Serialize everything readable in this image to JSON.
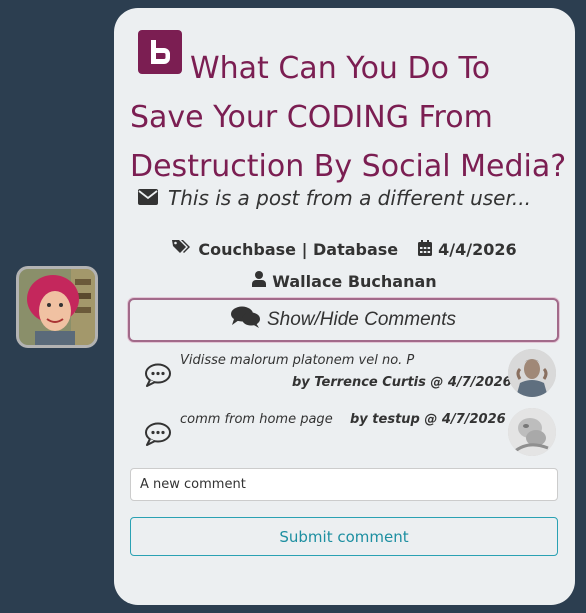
{
  "post": {
    "title": "What Can You Do To Save Your CODING From Destruction By Social Media?",
    "subtitle": "This is a post from a different user...",
    "tags": "Couchbase | Database",
    "date": "4/4/2026",
    "author": "Wallace Buchanan",
    "toggle_comments_label": "Show/Hide Comments"
  },
  "comments": [
    {
      "text": "Vidisse malorum platonem vel no. P",
      "byline": "by Terrence Curtis @ 4/7/2026"
    },
    {
      "text": "comm from home page",
      "byline": "by testup @ 4/7/2026"
    }
  ],
  "form": {
    "comment_placeholder": "A new comment",
    "submit_label": "Submit comment"
  },
  "colors": {
    "page_bg": "#2c3e50",
    "card_bg": "#eceff1",
    "title": "#7b1e52",
    "accent_teal": "#1d8fa1"
  },
  "icons": [
    "blogger-icon",
    "envelope-icon",
    "tags-icon",
    "calendar-icon",
    "user-icon",
    "comments-icon",
    "comment-bubble-icon"
  ]
}
